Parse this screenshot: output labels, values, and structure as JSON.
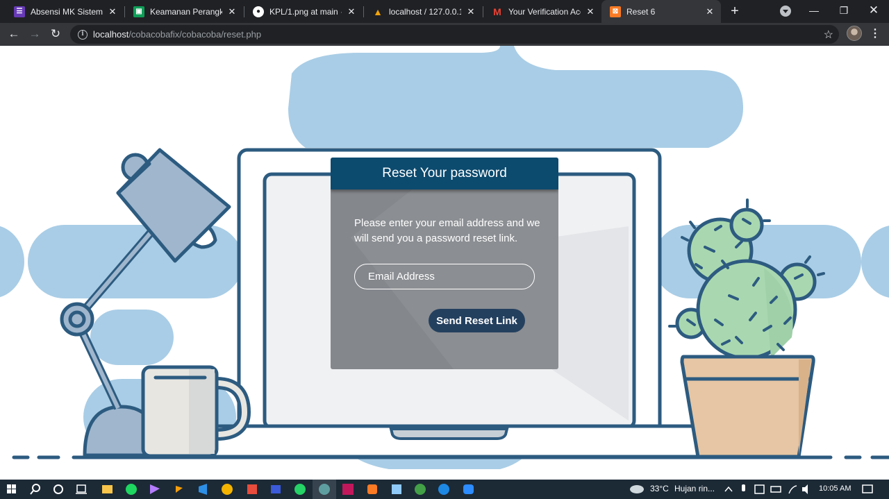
{
  "browser": {
    "tabs": [
      {
        "title": "Absensi MK Sistem Inf",
        "favicon_color": "#673ab7"
      },
      {
        "title": "Keamanan Perangkat L",
        "favicon_color": "#0f9d58"
      },
      {
        "title": "KPL/1.png at main · kh",
        "favicon_color": "#ffffff"
      },
      {
        "title": "localhost / 127.0.0.1 / c",
        "favicon_color": "#f0a30a"
      },
      {
        "title": "Your Verification Acco",
        "favicon_color": "#ea4335"
      },
      {
        "title": "Reset 6",
        "favicon_color": "#fb7a24"
      }
    ],
    "url_host": "localhost",
    "url_path": "/cobacobafix/cobacoba/reset.php"
  },
  "page": {
    "card_title": "Reset Your password",
    "description": "Please enter your email address and we will send you a password reset link.",
    "email_placeholder": "Email Address",
    "send_button": "Send Reset Link",
    "colors": {
      "card_header": "#0c4a6e",
      "card_body": "#84878c",
      "button": "#24405f",
      "blob": "#a9cde6",
      "outline": "#2d5b80"
    }
  },
  "taskbar": {
    "weather_temp": "33°C",
    "weather_text": "Hujan rin...",
    "time": "10:05 AM"
  }
}
